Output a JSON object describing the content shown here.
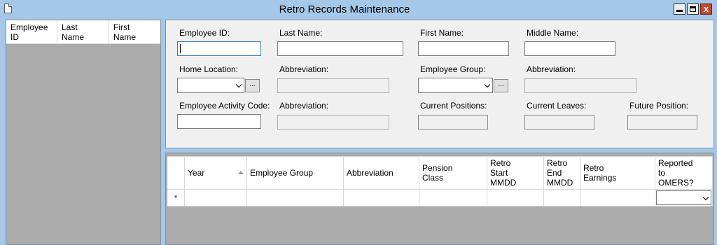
{
  "window": {
    "title": "Retro Records Maintenance",
    "controls": {
      "minimize_icon": "minimize-icon",
      "maximize_icon": "maximize-icon",
      "close_icon": "close-icon",
      "close_glyph": "x"
    }
  },
  "employee_list": {
    "columns": [
      {
        "line1": "Employee",
        "line2": "ID"
      },
      {
        "line1": "Last",
        "line2": "Name"
      },
      {
        "line1": "First",
        "line2": "Name"
      }
    ]
  },
  "form": {
    "employee_id": {
      "label": "Employee ID:",
      "value": ""
    },
    "last_name": {
      "label": "Last Name:",
      "value": ""
    },
    "first_name": {
      "label": "First Name:",
      "value": ""
    },
    "middle_name": {
      "label": "Middle Name:",
      "value": ""
    },
    "home_location": {
      "label": "Home Location:",
      "value": "",
      "lookup_label": "..."
    },
    "home_abbreviation": {
      "label": "Abbreviation:",
      "value": ""
    },
    "employee_group": {
      "label": "Employee Group:",
      "value": "",
      "lookup_label": "..."
    },
    "group_abbreviation": {
      "label": "Abbreviation:",
      "value": ""
    },
    "activity_code": {
      "label": "Employee Activity Code:",
      "value": ""
    },
    "activity_abbreviation": {
      "label": "Abbreviation:",
      "value": ""
    },
    "current_positions": {
      "label": "Current Positions:",
      "value": ""
    },
    "current_leaves": {
      "label": "Current Leaves:",
      "value": ""
    },
    "future_position": {
      "label": "Future Position:",
      "value": ""
    }
  },
  "grid": {
    "columns": {
      "year": "Year",
      "employee_group": "Employee Group",
      "abbreviation": "Abbreviation",
      "pension_class": [
        "Pension",
        "Class"
      ],
      "retro_start": [
        "Retro",
        "Start",
        "MMDD"
      ],
      "retro_end": [
        "Retro",
        "End",
        "MMDD"
      ],
      "retro_earnings": [
        "Retro",
        "Earnings"
      ],
      "reported": [
        "Reported",
        "to",
        "OMERS?"
      ]
    },
    "sort": {
      "column": "year",
      "direction": "ascending"
    },
    "new_row_marker": "*"
  }
}
